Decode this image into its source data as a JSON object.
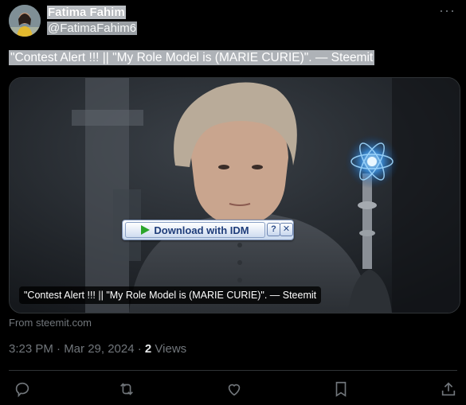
{
  "author": {
    "name": "Fatima Fahim",
    "handle": "@FatimaFahim6",
    "avatar_icon": "avatar-photo"
  },
  "more_label": "···",
  "tweet": {
    "text": "\"Contest Alert !!! || \"My Role Model is (MARIE CURIE)\". — Steemit"
  },
  "card": {
    "caption": "\"Contest Alert !!! || \"My Role Model is (MARIE CURIE)\". — Steemit",
    "idm_label": "Download with IDM",
    "idm_help": "?",
    "idm_close": "✕",
    "from": "From steemit.com"
  },
  "meta": {
    "time": "3:23 PM · Mar 29, 2024 · ",
    "views_count": "2",
    "views_label": " Views"
  },
  "actions": [
    "reply-icon",
    "retweet-icon",
    "like-icon",
    "bookmark-icon",
    "share-icon"
  ],
  "colors": {
    "background": "#000000",
    "muted": "#71767b",
    "border": "#2f3336",
    "idm_green": "#2ba52b"
  }
}
